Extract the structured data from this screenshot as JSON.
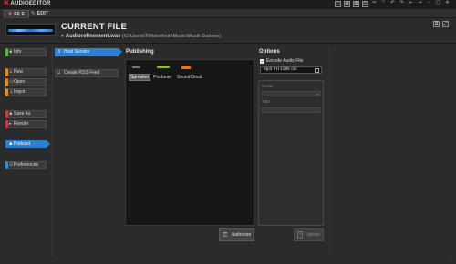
{
  "app": {
    "title": "AUDIOEDITOR",
    "logo_glyph": "Ж"
  },
  "titlebar_icons": [
    "layout-icon",
    "window-icon",
    "grid-icon",
    "dock-icon",
    "scissors-icon",
    "chevron-up-icon",
    "undo-icon",
    "redo-icon",
    "back-icon",
    "forward-icon",
    "minimize-icon",
    "maximize-icon",
    "close-icon"
  ],
  "tabs": {
    "file_label": "FILE",
    "edit_label": "EDIT"
  },
  "header": {
    "title": "CURRENT FILE",
    "file_name": "Audiorefinement.wav",
    "file_path": "(C:\\Users\\TWidenhein\\Music\\Musik Dateien)"
  },
  "left_menu": {
    "info": "Info",
    "new": "New",
    "open": "Open",
    "import": "Import",
    "save_as": "Save As",
    "render": "Render",
    "podcast": "Podcast",
    "preferences": "Preferences"
  },
  "podcast_menu": {
    "host_service": "Host Service",
    "create_rss_feed": "Create RSS Feed"
  },
  "publishing": {
    "title": "Publishing",
    "services": [
      "Spreaker",
      "Podbean",
      "SoundCloud"
    ],
    "authorize_label": "Authorize"
  },
  "options": {
    "title": "Options",
    "encode_label": "Encode Audio File",
    "encode_checked": true,
    "format_value": "Mp3 FH 128k cbr",
    "show_label": "Show",
    "title_label": "Title",
    "upload_label": "Upload"
  },
  "colors": {
    "accent": "#2d7fd0",
    "green": "#4bbf3c",
    "orange": "#e68a22",
    "red": "#d03a3a",
    "purple": "#b04ac8",
    "blue": "#2f8fe0"
  }
}
